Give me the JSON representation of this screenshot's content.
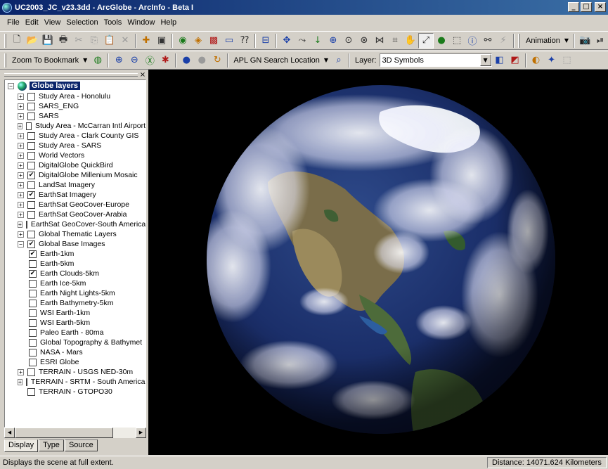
{
  "window": {
    "title": "UC2003_JC_v23.3dd - ArcGlobe - ArcInfo - Beta I"
  },
  "menu": [
    "File",
    "Edit",
    "View",
    "Selection",
    "Tools",
    "Window",
    "Help"
  ],
  "toolbar": {
    "animation_label": "Animation",
    "zoom_bookmark_label": "Zoom To Bookmark",
    "search_location_label": "APL GN Search Location",
    "layer_label": "Layer:",
    "layer_value": "3D Symbols"
  },
  "toc": {
    "root": "Globe layers",
    "layers": [
      {
        "name": "Study Area - Honolulu",
        "checked": false,
        "expander": "+",
        "level": 0
      },
      {
        "name": "SARS_ENG",
        "checked": false,
        "expander": "+",
        "level": 0
      },
      {
        "name": "SARS",
        "checked": false,
        "expander": "+",
        "level": 0
      },
      {
        "name": "Study Area - McCarran Intl Airport",
        "checked": false,
        "expander": "+",
        "level": 0
      },
      {
        "name": "Study Area - Clark County GIS",
        "checked": false,
        "expander": "+",
        "level": 0
      },
      {
        "name": "Study Area - SARS",
        "checked": false,
        "expander": "+",
        "level": 0
      },
      {
        "name": "World Vectors",
        "checked": false,
        "expander": "+",
        "level": 0
      },
      {
        "name": "DigitalGlobe QuickBird",
        "checked": false,
        "expander": "+",
        "level": 0
      },
      {
        "name": "DigitalGlobe Millenium Mosaic",
        "checked": true,
        "expander": "+",
        "level": 0
      },
      {
        "name": "LandSat Imagery",
        "checked": false,
        "expander": "+",
        "level": 0
      },
      {
        "name": "EarthSat Imagery",
        "checked": true,
        "expander": "+",
        "level": 0
      },
      {
        "name": "EarthSat GeoCover-Europe",
        "checked": false,
        "expander": "+",
        "level": 0
      },
      {
        "name": "EarthSat GeoCover-Arabia",
        "checked": false,
        "expander": "+",
        "level": 0
      },
      {
        "name": "EarthSat GeoCover-South America",
        "checked": false,
        "expander": "+",
        "level": 0
      },
      {
        "name": "Global Thematic Layers",
        "checked": false,
        "expander": "+",
        "level": 0
      },
      {
        "name": "Global Base Images",
        "checked": true,
        "expander": "−",
        "level": 0
      },
      {
        "name": "Earth-1km",
        "checked": true,
        "expander": "",
        "level": 1
      },
      {
        "name": "Earth-5km",
        "checked": false,
        "expander": "",
        "level": 1
      },
      {
        "name": "Earth Clouds-5km",
        "checked": true,
        "expander": "",
        "level": 1
      },
      {
        "name": "Earth Ice-5km",
        "checked": false,
        "expander": "",
        "level": 1
      },
      {
        "name": "Earth Night Lights-5km",
        "checked": false,
        "expander": "",
        "level": 1
      },
      {
        "name": "Earth Bathymetry-5km",
        "checked": false,
        "expander": "",
        "level": 1
      },
      {
        "name": "WSI Earth-1km",
        "checked": false,
        "expander": "",
        "level": 1
      },
      {
        "name": "WSI Earth-5km",
        "checked": false,
        "expander": "",
        "level": 1
      },
      {
        "name": "Paleo Earth - 80ma",
        "checked": false,
        "expander": "",
        "level": 1
      },
      {
        "name": "Global Topography & Bathymet",
        "checked": false,
        "expander": "",
        "level": 1
      },
      {
        "name": "NASA - Mars",
        "checked": false,
        "expander": "",
        "level": 1
      },
      {
        "name": "ESRI Globe",
        "checked": false,
        "expander": "",
        "level": 1
      },
      {
        "name": "TERRAIN - USGS NED-30m",
        "checked": false,
        "expander": "+",
        "level": 0
      },
      {
        "name": "TERRAIN - SRTM - South America -",
        "checked": false,
        "expander": "+",
        "level": 0
      },
      {
        "name": "TERRAIN - GTOPO30",
        "checked": false,
        "expander": "",
        "level": 0
      }
    ],
    "tabs": [
      "Display",
      "Type",
      "Source"
    ],
    "active_tab": "Display"
  },
  "status": {
    "message": "Displays the scene at full extent.",
    "distance": "Distance:  14071.624 Kilometers"
  },
  "icons": {
    "check": "✔",
    "dropdown": "▼",
    "scroll_left": "◀",
    "scroll_right": "▶",
    "close": "×"
  }
}
